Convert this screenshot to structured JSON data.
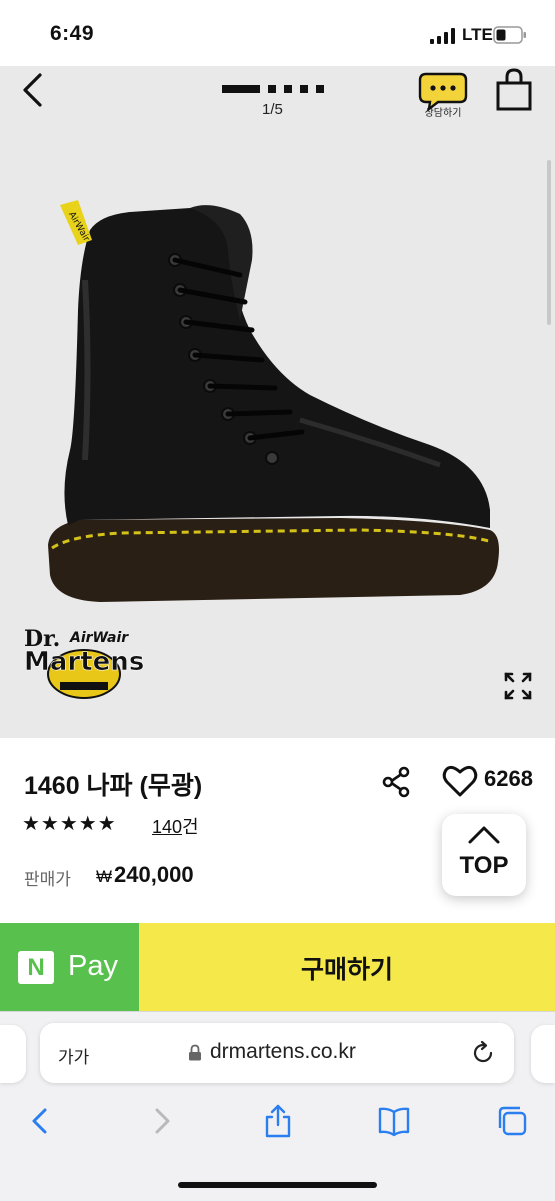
{
  "status_bar": {
    "time": "6:49",
    "network": "LTE"
  },
  "hero": {
    "pager_text": "1/5",
    "chat_label": "상담하기",
    "logo_text": "Dr. AirWair Martens"
  },
  "product": {
    "title": "1460 나파 (무광)",
    "like_count": "6268",
    "stars": "★★★★★",
    "rating": 5,
    "review_count": "140",
    "review_suffix": "건",
    "seller_label": "판매가",
    "price_symbol": "₩",
    "price": "240,000"
  },
  "top_button": {
    "label": "TOP"
  },
  "actions": {
    "npay_logo": "N",
    "npay_label": "Pay",
    "buy_label": "구매하기"
  },
  "browser": {
    "aa_label": "가가",
    "url": "drmartens.co.kr"
  },
  "icons": {
    "back": "back-chevron-icon",
    "chat": "chat-bubble-icon",
    "bag": "shopping-bag-icon",
    "expand": "expand-icon",
    "share": "share-icon",
    "like": "heart-icon",
    "top": "chevron-up-icon",
    "lock": "lock-icon",
    "reload": "reload-icon",
    "safari_back": "chevron-left-icon",
    "safari_forward": "chevron-right-icon",
    "safari_share": "share-up-icon",
    "safari_bookmarks": "book-icon",
    "safari_tabs": "tabs-icon"
  },
  "colors": {
    "npay_green": "#58c14d",
    "buy_yellow": "#f4e84b",
    "chat_yellow": "#f2d43a",
    "safari_blue": "#2a7ef0",
    "hero_bg": "#e9e9e9"
  }
}
